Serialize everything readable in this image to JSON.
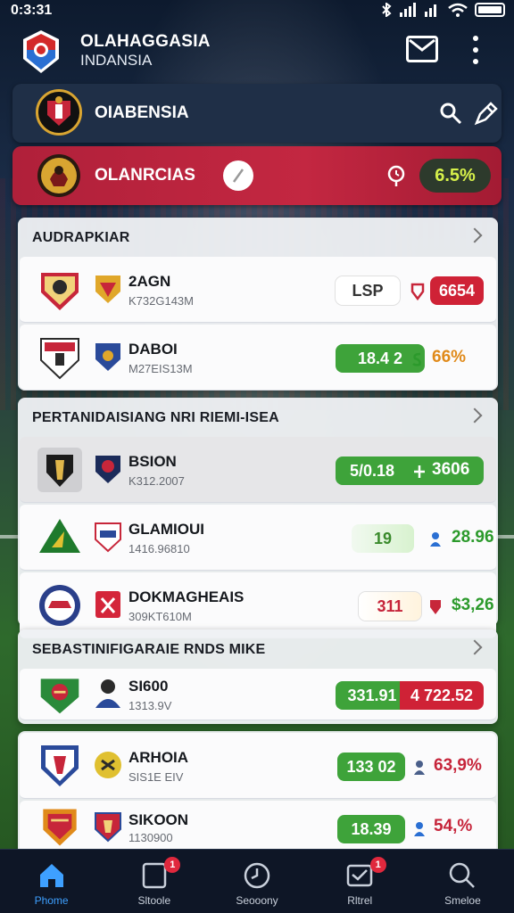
{
  "status_bar": {
    "time": "0:3:31"
  },
  "header": {
    "title": "OLAHAGGASIA",
    "subtitle": "INDANSIA"
  },
  "top_bar": {
    "label": "OIABENSIA"
  },
  "highlight_bar": {
    "label": "OLANRCIAS",
    "value": "6.5%"
  },
  "sections": [
    {
      "title": "AUDRAPKIAR",
      "rows": [
        {
          "name": "2AGN",
          "meta": "K732G143M",
          "left": "LSP",
          "right": "6654"
        },
        {
          "name": "DABOI",
          "meta": "M27EIS13M",
          "left": "18.4 2",
          "right": "66%"
        }
      ]
    },
    {
      "title": "PERTANIDAISIANG NRI RIEMI-ISEA",
      "rows": [
        {
          "name": "BSION",
          "meta": "K312.2007",
          "left": "5/0.18",
          "right": "3606"
        },
        {
          "name": "GLAMIOUI",
          "meta": "1416.96810",
          "left": "19",
          "right": "28.96"
        },
        {
          "name": "DOKMAGHEAIS",
          "meta": "309KT610M",
          "left": "311",
          "right": "$3,26"
        }
      ]
    },
    {
      "title": "SEBASTINIFIGARAIE RNDS MIKE",
      "rows": [
        {
          "name": "SI600",
          "meta": "1313.9V",
          "left": "331.91",
          "right": "4 722.52"
        }
      ]
    },
    {
      "title": "",
      "rows": [
        {
          "name": "ARHOIA",
          "meta": "SIS1E EIV",
          "left": "133 02",
          "right": "63,9%"
        },
        {
          "name": "SIKOON",
          "meta": "1130900",
          "left": "18.39",
          "right": "54,%"
        }
      ]
    }
  ],
  "nav": [
    {
      "label": "Phome",
      "icon": "home-icon"
    },
    {
      "label": "Sltoole",
      "icon": "clipboard-icon",
      "badge": "1"
    },
    {
      "label": "Seooony",
      "icon": "clock-icon"
    },
    {
      "label": "Rltrel",
      "icon": "inbox-icon",
      "badge": "1"
    },
    {
      "label": "Smeloe",
      "icon": "search-icon"
    }
  ],
  "colors": {
    "accent_red": "#c32741",
    "accent_green": "#3ea33a",
    "nav_active": "#3ea0ff"
  }
}
